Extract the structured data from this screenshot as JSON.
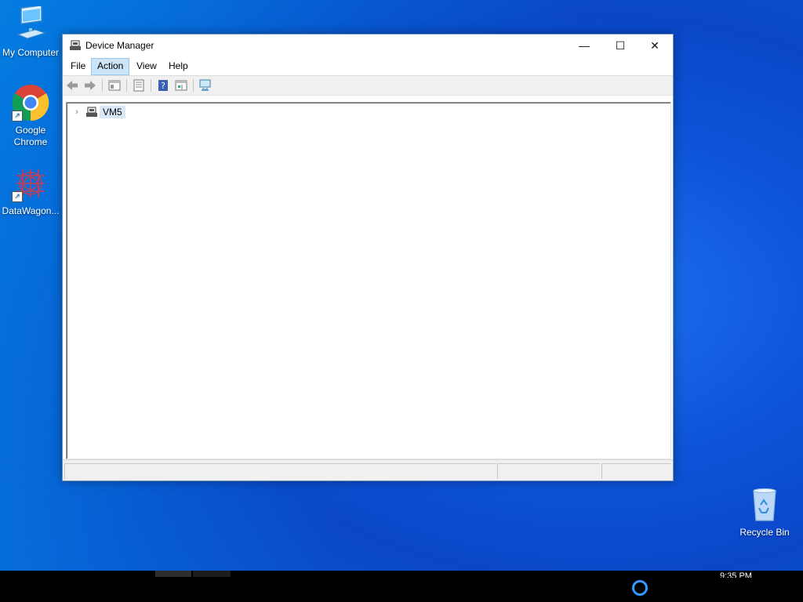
{
  "desktop": {
    "icons": [
      {
        "label": "My Computer"
      },
      {
        "label": "Google Chrome"
      },
      {
        "label": "DataWagon..."
      },
      {
        "label": "Recycle Bin"
      }
    ]
  },
  "window": {
    "title": "Device Manager",
    "controls": {
      "minimize": "—",
      "maximize": "☐",
      "close": "✕"
    },
    "menu": [
      "File",
      "Action",
      "View",
      "Help"
    ],
    "active_menu": "Action",
    "toolbar_icons": [
      "back-icon",
      "forward-icon",
      "console-tree-icon",
      "properties-icon",
      "help-icon",
      "action-pane-icon",
      "scan-hardware-icon"
    ],
    "tree": {
      "root_label": "VM5",
      "expander": "›"
    }
  },
  "taskbar": {
    "clock": "9:35 PM",
    "accent": "#2f9bff"
  }
}
